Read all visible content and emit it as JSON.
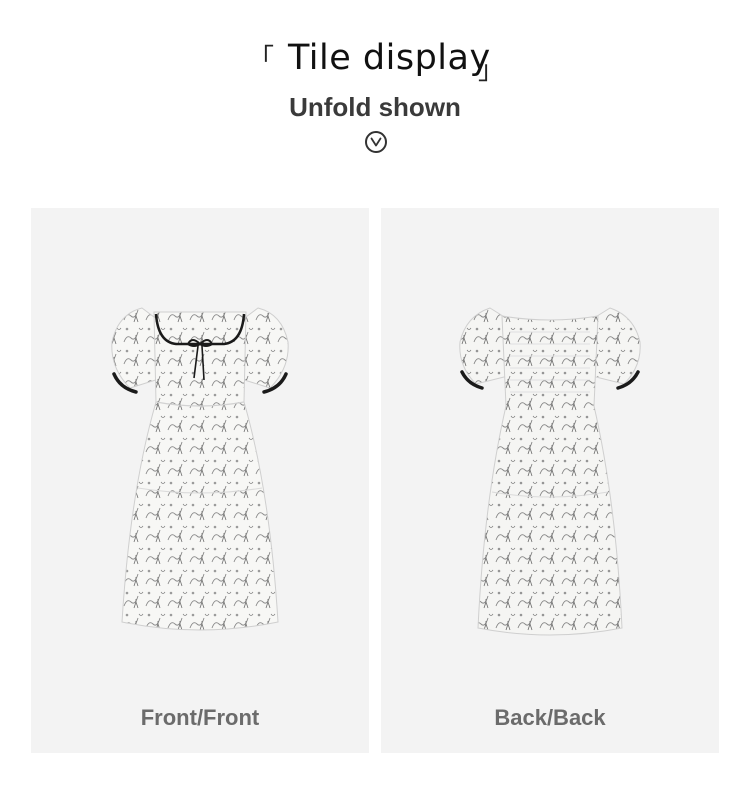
{
  "header": {
    "bracket_open": "「",
    "title": "Tile display",
    "bracket_close": "」",
    "subtitle": "Unfold shown",
    "expand_icon": "chevron-down-circle-icon"
  },
  "panels": [
    {
      "caption": "Front/Front",
      "image": "dress-front-image"
    },
    {
      "caption": "Back/Back",
      "image": "dress-back-image"
    }
  ],
  "colors": {
    "panel_background": "#f3f3f3",
    "caption_text": "#6b6b6b",
    "trim": "#1a1a1a"
  }
}
